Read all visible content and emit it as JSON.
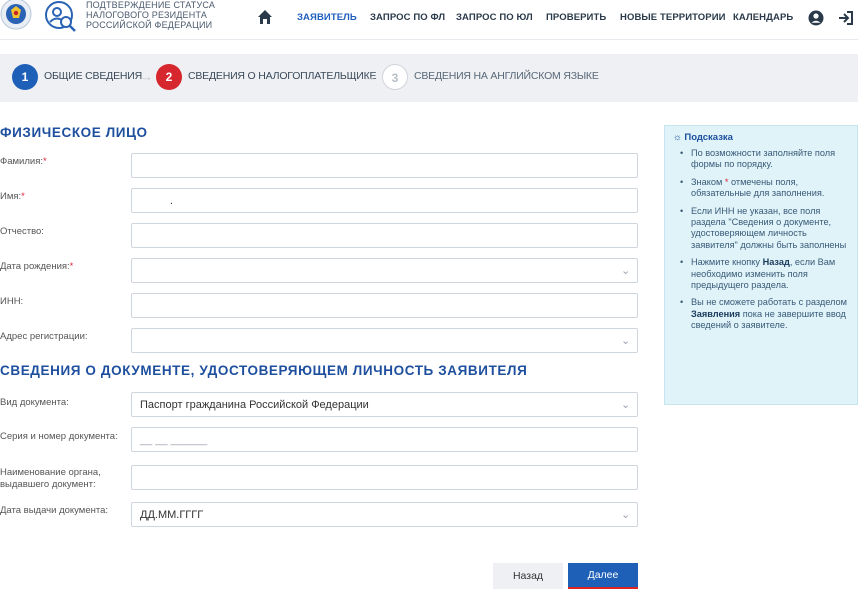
{
  "header": {
    "brand_lines": [
      "ПОДТВЕРЖДЕНИЕ СТАТУСА",
      "НАЛОГОВОГО РЕЗИДЕНТА",
      "РОССИЙСКОЙ ФЕДЕРАЦИИ"
    ],
    "nav": [
      "ЗАЯВИТЕЛЬ",
      "ЗАПРОС ПО ФЛ",
      "ЗАПРОС ПО ЮЛ",
      "ПРОВЕРИТЬ",
      "НОВЫЕ ТЕРРИТОРИИ",
      "КАЛЕНДАРЬ"
    ],
    "active_nav": "ЗАЯВИТЕЛЬ",
    "icons": [
      "home-icon",
      "user-icon",
      "logout-icon"
    ]
  },
  "steps": [
    {
      "number": "1",
      "label": "ОБЩИЕ СВЕДЕНИЯ",
      "state": "done"
    },
    {
      "number": "2",
      "label": "СВЕДЕНИЯ О НАЛОГОПЛАТЕЛЬЩИКЕ",
      "state": "current"
    },
    {
      "number": "3",
      "label": "СВЕДЕНИЯ НА АНГЛИЙСКОМ ЯЗЫКЕ",
      "state": "pending"
    }
  ],
  "person": {
    "title": "ФИЗИЧЕСКОЕ ЛИЦО",
    "fields": [
      {
        "label": "Фамилия:",
        "required": true,
        "value": ""
      },
      {
        "label": "Имя:",
        "required": true,
        "value": "."
      },
      {
        "label": "Отчество:",
        "required": false,
        "value": ""
      },
      {
        "label": "Дата рождения:",
        "required": true,
        "value": "",
        "dropdown": true
      },
      {
        "label": "ИНН:",
        "required": false,
        "value": ""
      },
      {
        "label": "Адрес регистрации:",
        "required": false,
        "value": "",
        "dropdown": true
      }
    ]
  },
  "document": {
    "title": "СВЕДЕНИЯ О ДОКУМЕНТЕ, УДОСТОВЕРЯЮЩЕМ ЛИЧНОСТЬ ЗАЯВИТЕЛЯ",
    "fields": [
      {
        "label": "Вид документа:",
        "value": "Паспорт гражданина Российской Федерации",
        "dropdown": true
      },
      {
        "label": "Серия и номер документа:",
        "placeholder": "__ __ ______"
      },
      {
        "label": "Наименование органа, выдавшего документ:",
        "value": ""
      },
      {
        "label": "Дата выдачи документа:",
        "value": "ДД.ММ.ГГГГ",
        "dropdown": true
      }
    ]
  },
  "hint": {
    "title": "Подсказка",
    "items": [
      "По возможности заполняйте поля формы по порядку.",
      "Знаком * отмечены поля, обязательные для заполнения.",
      "Если ИНН не указан, все поля раздела \"Сведения о документе, удостоверяющем личность заявителя\" должны быть заполнены",
      "Нажмите кнопку Назад, если Вам необходимо изменить поля предыдущего раздела.",
      "Вы не сможете работать с разделом Заявления пока не завершите ввод сведений о заявителе."
    ]
  },
  "buttons": {
    "back": "Назад",
    "next": "Далее"
  },
  "colors": {
    "accent": "#1d4f9e",
    "step_done": "#1e5fb8",
    "step_current": "#d6262e",
    "hint_bg": "#dff3f9"
  }
}
